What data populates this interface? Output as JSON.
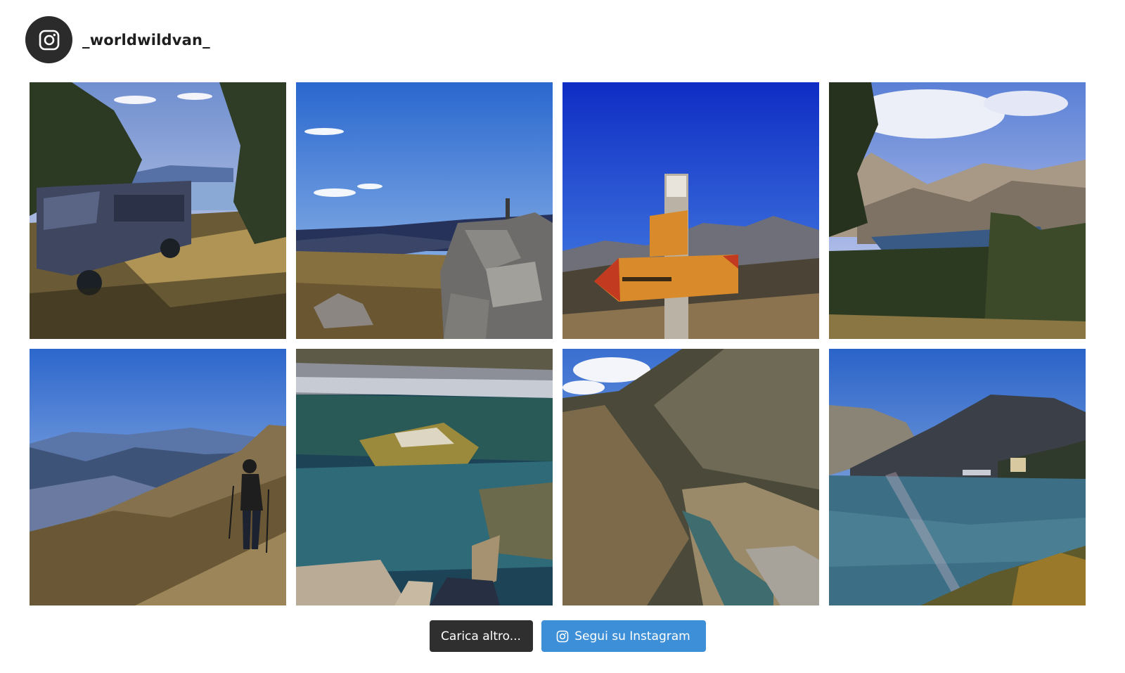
{
  "header": {
    "username": "_worldwildvan_",
    "avatar_icon": "instagram-icon"
  },
  "posts": [
    {
      "name": "post-van-by-lake"
    },
    {
      "name": "post-stone-cairn"
    },
    {
      "name": "post-trail-signpost"
    },
    {
      "name": "post-mountain-lake-view"
    },
    {
      "name": "post-hiker-ridge"
    },
    {
      "name": "post-river-pool"
    },
    {
      "name": "post-valley-river"
    },
    {
      "name": "post-reservoir-dam"
    }
  ],
  "actions": {
    "load_more_label": "Carica altro...",
    "follow_label": "Segui su Instagram",
    "follow_icon": "instagram-icon"
  },
  "colors": {
    "load_more_bg": "#2f2f2f",
    "follow_bg": "#3d8fd8",
    "avatar_bg": "#2b2b2b"
  }
}
